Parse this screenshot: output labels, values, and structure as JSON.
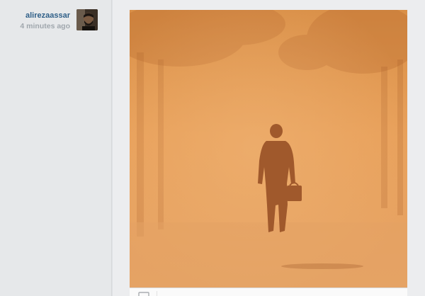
{
  "post": {
    "username": "alirezaassar",
    "timestamp": "4 minutes ago"
  },
  "icons": {
    "avatar": "user-avatar",
    "comment": "comment-icon"
  },
  "colors": {
    "username": "#2f5f88",
    "timestamp": "#a0a7ad",
    "photo_tone": "#e09a52"
  }
}
